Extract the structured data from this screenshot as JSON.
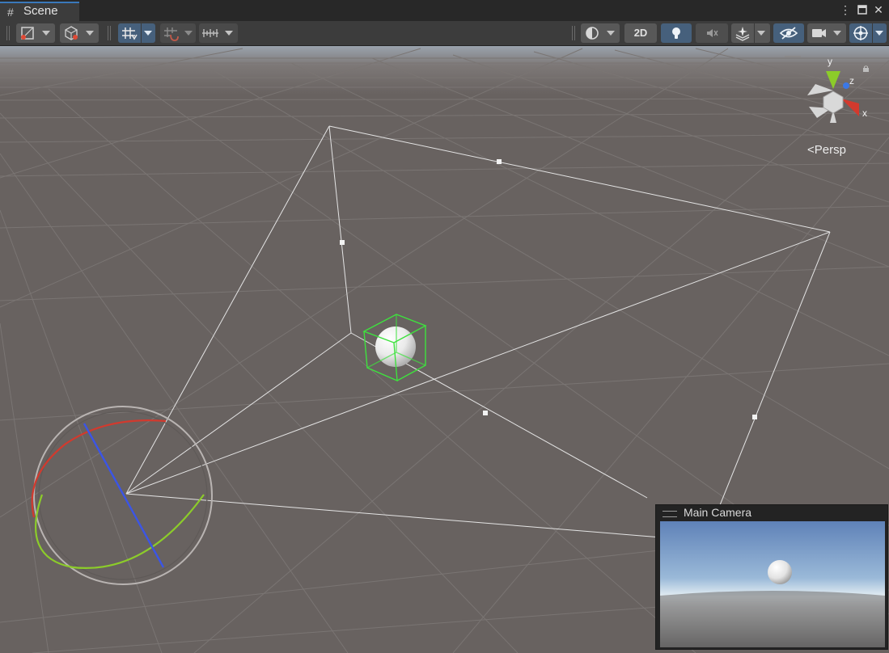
{
  "window": {
    "tab_label": "Scene",
    "tab_icon": "grid-hash-icon",
    "controls": [
      "more-menu-icon",
      "maximize-icon",
      "close-icon"
    ]
  },
  "toolbar": {
    "left_tools": [
      {
        "name": "draw-mode-dropdown",
        "icon": "shaded-mode-icon"
      },
      {
        "name": "render-mode-dropdown",
        "icon": "cube-gizmo-icon"
      },
      {
        "name": "grid-snapping-dropdown",
        "icon": "grid-snap-icon",
        "active": true
      },
      {
        "name": "increment-snap-dropdown",
        "icon": "snap-increment-icon"
      },
      {
        "name": "ruler-dropdown",
        "icon": "ruler-icon"
      }
    ],
    "right_tools": [
      {
        "name": "draw-mode-toggle",
        "icon": "globe-shading-icon"
      },
      {
        "name": "2d-toggle",
        "label": "2D"
      },
      {
        "name": "lighting-toggle",
        "icon": "lightbulb-icon",
        "active": true
      },
      {
        "name": "audio-toggle",
        "icon": "speaker-muted-icon"
      },
      {
        "name": "effects-dropdown",
        "icon": "effects-layers-icon"
      },
      {
        "name": "scene-visibility-toggle",
        "icon": "eye-hidden-icon",
        "active": true
      },
      {
        "name": "camera-dropdown",
        "icon": "camera-icon"
      },
      {
        "name": "gizmos-dropdown",
        "icon": "gizmo-globe-icon",
        "active": true
      }
    ],
    "label_2d": "2D"
  },
  "viewport": {
    "projection_label": "Persp",
    "orientation_gizmo": {
      "x_label": "x",
      "y_label": "y",
      "z_label": "z"
    },
    "selected_object": "sphere",
    "colors": {
      "background": "#686260",
      "grid": "#7a7573",
      "frustum": "#e6e6e6",
      "selection": "#33e633",
      "axis_x": "#d23a2e",
      "axis_y": "#8ccc2a",
      "axis_z": "#3b55e6"
    }
  },
  "camera_preview": {
    "title": "Main Camera"
  }
}
